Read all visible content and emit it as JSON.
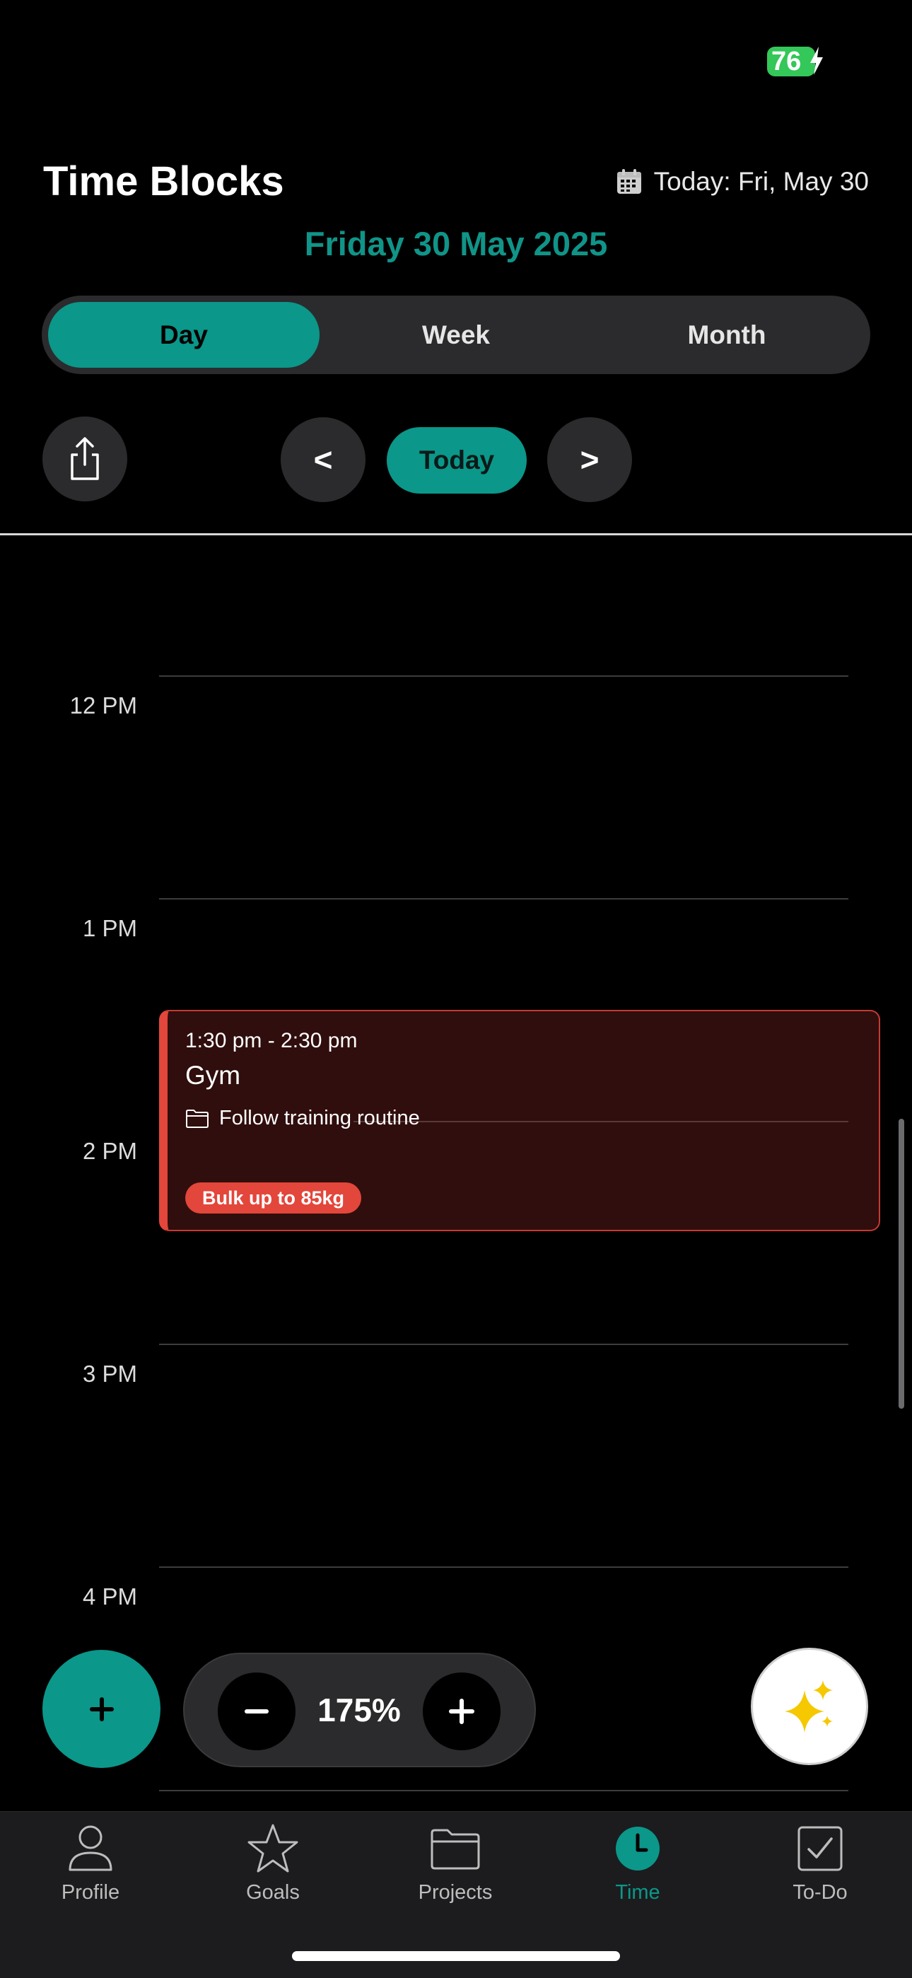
{
  "status_bar": {
    "battery_level": "76",
    "battery_color": "#34c759",
    "charging_icon": "bolt-icon"
  },
  "header": {
    "title": "Time Blocks",
    "today_label": "Today: Fri, May 30",
    "today_icon": "calendar-icon",
    "date_heading": "Friday 30 May 2025",
    "accent_color": "#0b978a"
  },
  "view_switcher": {
    "options": [
      "Day",
      "Week",
      "Month"
    ],
    "selected": "Day"
  },
  "navigation": {
    "share_icon": "share-icon",
    "prev_label": "<",
    "today_label": "Today",
    "next_label": ">"
  },
  "timeline": {
    "hours": [
      "12 PM",
      "1 PM",
      "2 PM",
      "3 PM",
      "4 PM"
    ]
  },
  "event": {
    "time_range": "1:30 pm - 2:30 pm",
    "title": "Gym",
    "description": "Follow training routine",
    "description_icon": "folder-icon",
    "tag": "Bulk up to 85kg",
    "color": "#e3463b"
  },
  "controls": {
    "add_icon": "plus-icon",
    "zoom_out_icon": "minus-icon",
    "zoom_value": "175%",
    "zoom_in_icon": "plus-icon",
    "ai_icon": "sparkles-icon"
  },
  "tab_bar": {
    "items": [
      {
        "label": "Profile",
        "icon": "person-icon"
      },
      {
        "label": "Goals",
        "icon": "star-icon"
      },
      {
        "label": "Projects",
        "icon": "folder-icon"
      },
      {
        "label": "Time",
        "icon": "clock-icon"
      },
      {
        "label": "To-Do",
        "icon": "checkbox-icon"
      }
    ],
    "selected": "Time"
  }
}
